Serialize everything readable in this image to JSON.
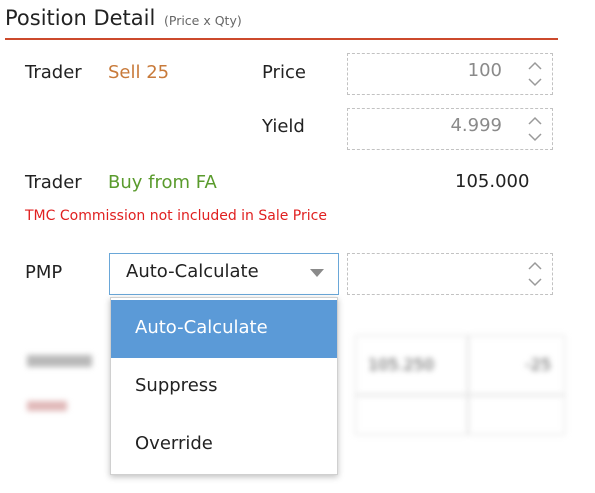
{
  "header": {
    "title": "Position Detail",
    "subtitle": "(Price x Qty)"
  },
  "sell_row": {
    "label": "Trader",
    "action": "Sell 25"
  },
  "price": {
    "label": "Price",
    "value": "100"
  },
  "yield": {
    "label": "Yield",
    "value": "4.999"
  },
  "buy_row": {
    "label": "Trader",
    "action": "Buy from FA",
    "value": "105.000"
  },
  "warning": "TMC Commission not included in Sale Price",
  "pmp": {
    "label": "PMP",
    "selected": "Auto-Calculate",
    "options": [
      "Auto-Calculate",
      "Suppress",
      "Override"
    ],
    "override_value": ""
  },
  "background_table": {
    "price": "105.250",
    "qty": "-25"
  },
  "colors": {
    "accent_rule": "#cc4a2c",
    "sell": "#c87a3a",
    "buy": "#5a9b2d",
    "warning": "#e02020",
    "selection": "#5b9ad7"
  }
}
